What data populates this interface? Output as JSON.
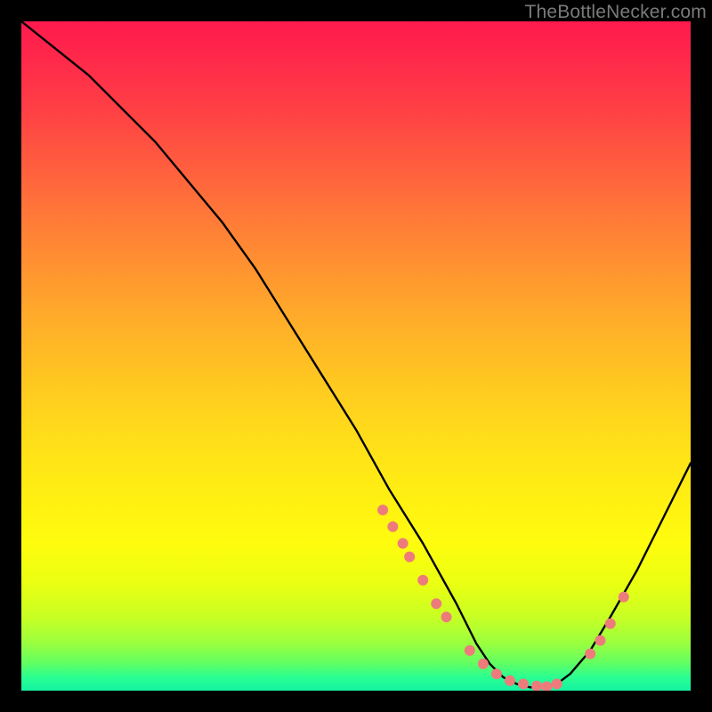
{
  "watermark": "TheBottleNecker.com",
  "chart_data": {
    "type": "line",
    "title": "",
    "xlabel": "",
    "ylabel": "",
    "xlim": [
      0,
      100
    ],
    "ylim": [
      0,
      100
    ],
    "series": [
      {
        "name": "curve",
        "x": [
          0,
          5,
          10,
          15,
          20,
          25,
          30,
          35,
          40,
          45,
          50,
          55,
          60,
          65,
          68,
          70,
          72,
          74,
          76,
          78,
          80,
          82,
          85,
          88,
          92,
          96,
          100
        ],
        "values": [
          100,
          96,
          92,
          87,
          82,
          76,
          70,
          63,
          55,
          47,
          39,
          30,
          22,
          13,
          7,
          4,
          2,
          1,
          0.5,
          0.5,
          1,
          2.5,
          6,
          11,
          18,
          26,
          34
        ]
      }
    ],
    "markers": {
      "name": "points",
      "color_hex": "#ee7b7b",
      "x": [
        54,
        55.5,
        57,
        58,
        60,
        62,
        63.5,
        67,
        69,
        71,
        73,
        75,
        77,
        78.5,
        80,
        85,
        86.5,
        88,
        90
      ],
      "values": [
        27,
        24.5,
        22,
        20,
        16.5,
        13,
        11,
        6,
        4,
        2.5,
        1.5,
        1,
        0.7,
        0.6,
        1,
        5.5,
        7.5,
        10,
        14
      ]
    },
    "gradient": {
      "top_hex": "#ff1a4d",
      "mid_hex": "#ffe010",
      "bottom_hex": "#14f2a3"
    }
  }
}
